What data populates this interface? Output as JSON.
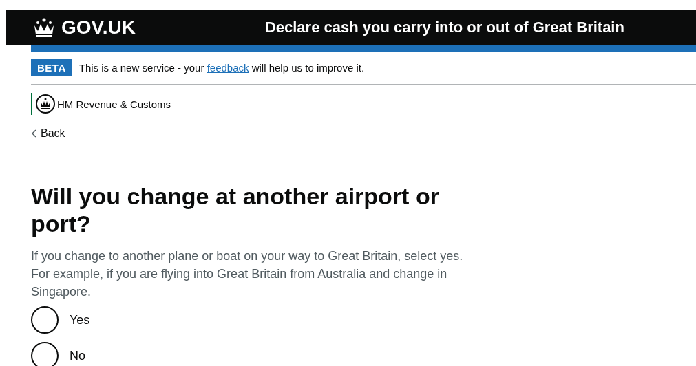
{
  "header": {
    "logo": "GOV.UK",
    "service_name": "Declare cash you carry into or out of Great Britain"
  },
  "phase_banner": {
    "tag": "BETA",
    "text_before": "This is a new service - your ",
    "link": "feedback",
    "text_after": " will help us to improve it."
  },
  "organisation": "HM Revenue & Customs",
  "back_link": "Back",
  "question": {
    "heading": "Will you change at another airport or port?",
    "hint": "If you change to another plane or boat on your way to Great Britain, select yes. For example, if you are flying into Great Britain from Australia and change in Singapore.",
    "options": [
      {
        "label": "Yes",
        "selected": false
      },
      {
        "label": "No",
        "selected": false
      }
    ]
  }
}
